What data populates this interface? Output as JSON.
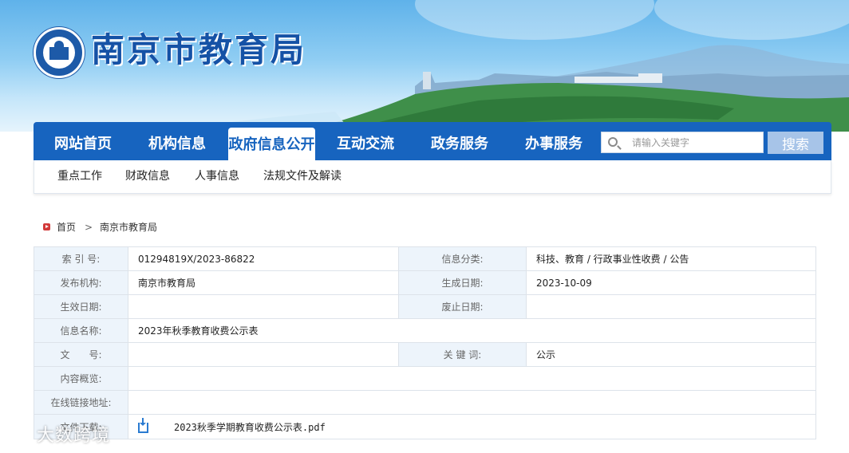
{
  "header": {
    "site_title": "南京市教育局",
    "logo_name": "nanjing-education-seal"
  },
  "nav": {
    "items": [
      {
        "label": "网站首页"
      },
      {
        "label": "机构信息"
      },
      {
        "label": "政府信息公开"
      },
      {
        "label": "互动交流"
      },
      {
        "label": "政务服务"
      },
      {
        "label": "办事服务"
      }
    ],
    "active_index": 2,
    "search_placeholder": "请输入关键字",
    "search_button": "搜索"
  },
  "subnav": {
    "items": [
      {
        "label": "重点工作"
      },
      {
        "label": "财政信息"
      },
      {
        "label": "人事信息"
      },
      {
        "label": "法规文件及解读"
      }
    ]
  },
  "breadcrumb": {
    "home": "首页",
    "separator": ">",
    "current": "南京市教育局"
  },
  "info": {
    "index_no_label": "索 引 号:",
    "index_no": "01294819X/2023-86822",
    "category_label": "信息分类:",
    "category": "科技、教育 / 行政事业性收费 / 公告",
    "publisher_label": "发布机构:",
    "publisher": "南京市教育局",
    "created_label": "生成日期:",
    "created": "2023-10-09",
    "effective_label": "生效日期:",
    "effective": "",
    "repeal_label": "废止日期:",
    "repeal": "",
    "name_label": "信息名称:",
    "name": "2023年秋季教育收费公示表",
    "doc_no_label": "文　　号:",
    "doc_no": "",
    "keywords_label": "关 键 词:",
    "keywords": "公示",
    "overview_label": "内容概览:",
    "overview": "",
    "link_label": "在线链接地址:",
    "link": "",
    "download_label": "文件下载:",
    "download_file": "2023秋季学期教育收费公示表.pdf"
  },
  "watermark": {
    "text": "大数跨境"
  },
  "colors": {
    "nav_blue": "#1764bf",
    "label_bg": "#edf4fb",
    "title_blue": "#1552a6",
    "search_button": "#a7c4e8"
  }
}
